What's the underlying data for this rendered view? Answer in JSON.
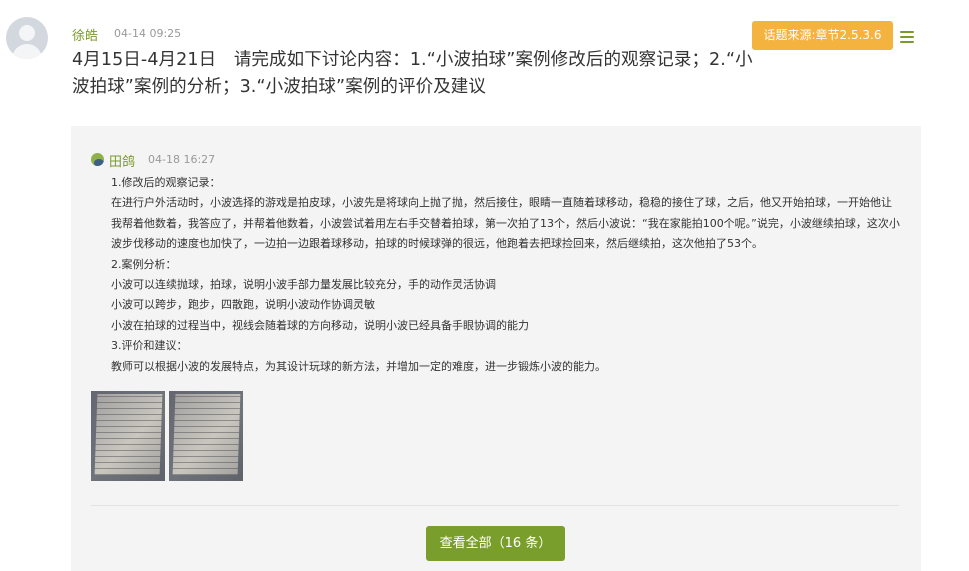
{
  "post": {
    "author": "徐皓",
    "time": "04-14 09:25",
    "topic_source": "话题来源:章节2.5.3.6",
    "menu_icon": "hamburger-menu-icon",
    "title": "4月15日-4月21日　请完成如下讨论内容：1.“小波拍球”案例修改后的观察记录；2.“小波拍球”案例的分析；3.“小波拍球”案例的评价及建议"
  },
  "reply": {
    "author": "田鸽",
    "time": "04-18 16:27",
    "lines": [
      "1.修改后的观察记录：",
      "在进行户外活动时，小波选择的游戏是拍皮球，小波先是将球向上抛了抛，然后接住，眼睛一直随着球移动，稳稳的接住了球，之后，他又开始拍球，一开始他让我帮着他数着，我答应了，并帮着他数着，小波尝试着用左右手交替着拍球，第一次拍了13个，然后小波说：“我在家能拍100个呢。”说完，小波继续拍球，这次小波步伐移动的速度也加快了，一边拍一边跟着球移动，拍球的时候球弹的很远，他跑着去把球捡回来，然后继续拍，这次他拍了53个。",
      "2.案例分析：",
      "小波可以连续抛球，拍球，说明小波手部力量发展比较充分，手的动作灵活协调",
      "小波可以跨步，跑步，四散跑，说明小波动作协调灵敏",
      "小波在拍球的过程当中，视线会随着球的方向移动，说明小波已经具备手眼协调的能力",
      "3.评价和建议：",
      "教师可以根据小波的发展特点，为其设计玩球的新方法，并增加一定的难度，进一步锻炼小波的能力。"
    ]
  },
  "view_all_label": "查看全部（16 条）"
}
